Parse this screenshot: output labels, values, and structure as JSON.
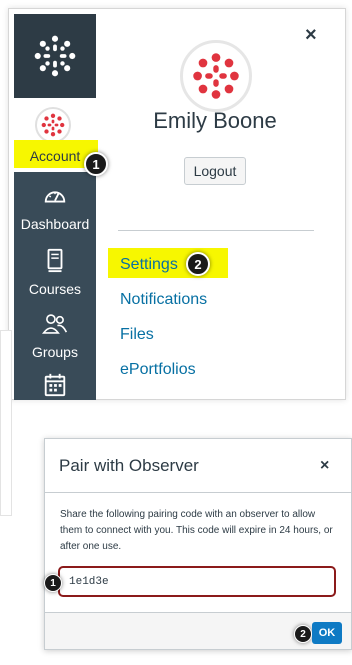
{
  "nav": {
    "account_label": "Account",
    "dashboard_label": "Dashboard",
    "courses_label": "Courses",
    "groups_label": "Groups"
  },
  "tray": {
    "user_name": "Emily Boone",
    "logout_label": "Logout",
    "close_glyph": "×",
    "links": [
      "Settings",
      "Notifications",
      "Files",
      "ePortfolios"
    ]
  },
  "dialog": {
    "title": "Pair with Observer",
    "close_glyph": "×",
    "body": "Share the following pairing code with an observer to allow them to connect with you. This code will expire in 24 hours, or after one use.",
    "pairing_code": "1e1d3e",
    "ok_label": "OK"
  },
  "annotations": {
    "step1": "1",
    "step2": "2",
    "dialog_step1": "1",
    "dialog_step2": "2",
    "highlight_color": "#f7f700"
  },
  "colors": {
    "rail": "#394b58",
    "brand_red": "#e0343f",
    "link": "#0770a3",
    "ok_button": "#0e7ac4"
  },
  "icons": [
    "canvas-logo-icon",
    "dashboard-icon",
    "courses-icon",
    "groups-icon",
    "calendar-icon",
    "close-icon"
  ]
}
